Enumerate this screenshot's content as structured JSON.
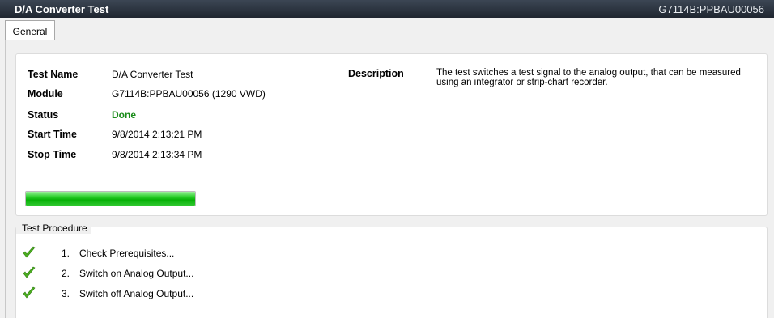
{
  "window": {
    "title": "D/A Converter Test",
    "module_id": "G7114B:PPBAU00056"
  },
  "tabs": [
    {
      "label": "General"
    }
  ],
  "info": {
    "test_name_label": "Test Name",
    "test_name": "D/A Converter Test",
    "module_label": "Module",
    "module": "G7114B:PPBAU00056 (1290 VWD)",
    "status_label": "Status",
    "status": "Done",
    "start_time_label": "Start Time",
    "start_time": "9/8/2014 2:13:21 PM",
    "stop_time_label": "Stop Time",
    "stop_time": "9/8/2014 2:13:34 PM",
    "description_label": "Description",
    "description": "The test switches a test signal to the analog output, that can be measured using an integrator or strip-chart recorder.",
    "progress_percent": 100
  },
  "procedure": {
    "heading": "Test Procedure",
    "steps": [
      {
        "number": "1.",
        "label": "Check Prerequisites...",
        "icon": "check-icon"
      },
      {
        "number": "2.",
        "label": "Switch on Analog Output...",
        "icon": "check-icon"
      },
      {
        "number": "3.",
        "label": "Switch off Analog Output...",
        "icon": "check-icon"
      }
    ]
  },
  "colors": {
    "status_done": "#1a8c1a",
    "check": "#4caf1f",
    "progress": "#06b006"
  }
}
